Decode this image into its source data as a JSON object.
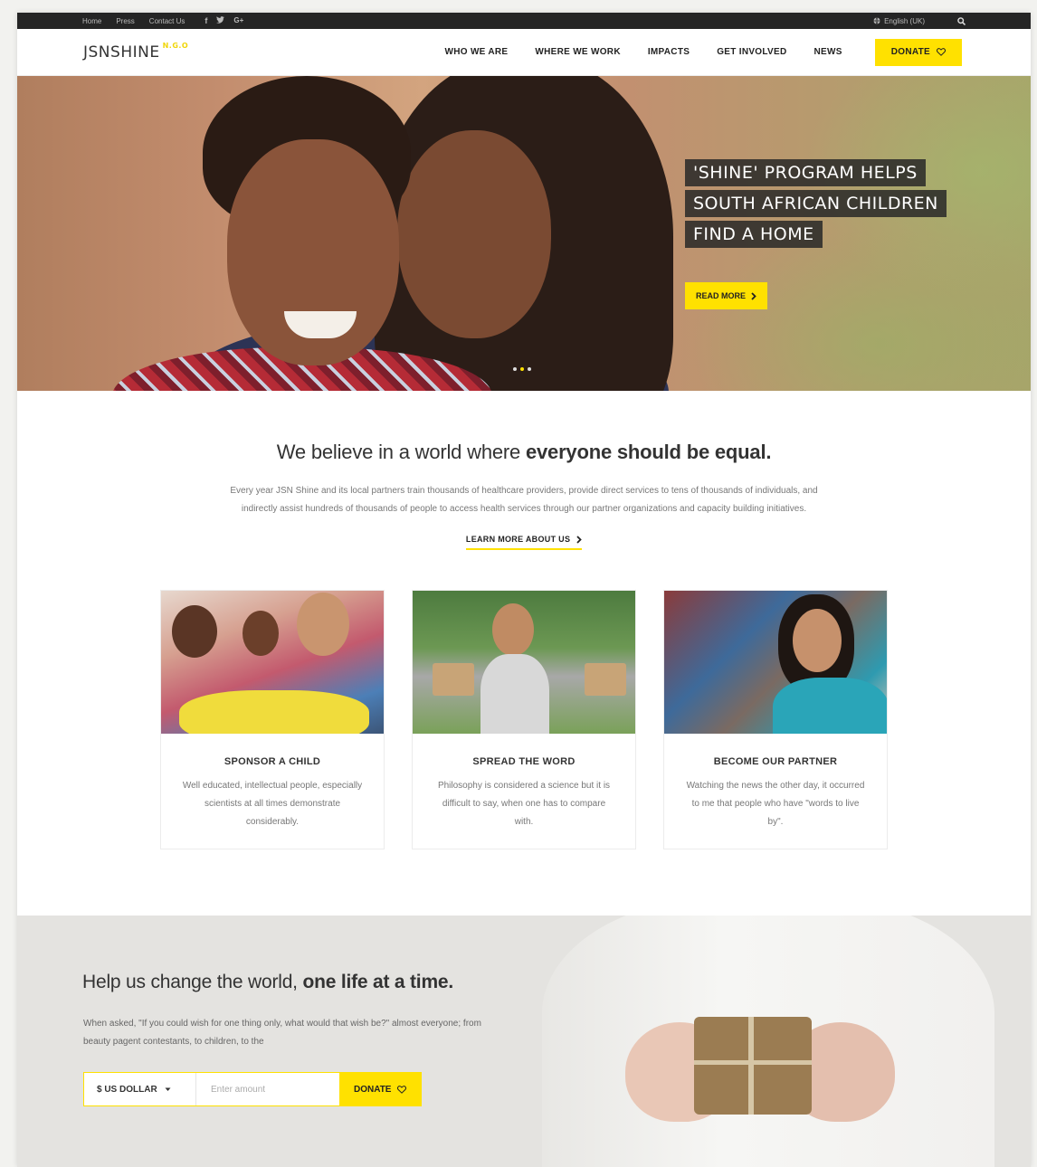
{
  "topbar": {
    "links": [
      "Home",
      "Press",
      "Contact Us"
    ],
    "social_icons": [
      "facebook-icon",
      "twitter-icon",
      "google-plus-icon"
    ],
    "language": "English (UK)"
  },
  "header": {
    "logo": "JSNSHINE",
    "logo_suffix": "N.G.O",
    "nav": [
      "WHO WE ARE",
      "WHERE WE WORK",
      "IMPACTS",
      "GET INVOLVED",
      "NEWS"
    ],
    "donate_label": "DONATE"
  },
  "hero": {
    "caption_lines": [
      "'SHINE' PROGRAM HELPS",
      "SOUTH AFRICAN CHILDREN",
      "FIND A HOME"
    ],
    "read_more": "READ MORE",
    "slide_count": 3,
    "active_slide": 2
  },
  "about": {
    "title_regular": "We believe in a world where ",
    "title_bold": "everyone should be equal.",
    "text": "Every year JSN Shine and its local partners train thousands of healthcare providers, provide direct services to tens of thousands of individuals, and indirectly assist hundreds of thousands of people to access health services through our partner organizations and capacity building initiatives.",
    "link": "LEARN MORE ABOUT US"
  },
  "cards": [
    {
      "title": "SPONSOR A CHILD",
      "text": "Well educated, intellectual people, especially scientists at all times demonstrate considerably."
    },
    {
      "title": "SPREAD THE WORD",
      "text": "Philosophy is considered a science but it is difficult to say, when one has to compare with."
    },
    {
      "title": "BECOME OUR PARTNER",
      "text": "Watching the news the other day, it occurred to me that people who have \"words to live by\"."
    }
  ],
  "help": {
    "title_regular": "Help us change the world, ",
    "title_bold": "one life at a time.",
    "text": "When asked, \"If you could wish for one thing only, what would that wish be?\" almost everyone; from beauty pagent contestants, to children, to the",
    "currency": "$ US DOLLAR",
    "amount_placeholder": "Enter amount",
    "donate_label": "DONATE"
  },
  "colors": {
    "accent": "#ffe100",
    "topbar": "#252525",
    "text": "#333333"
  }
}
